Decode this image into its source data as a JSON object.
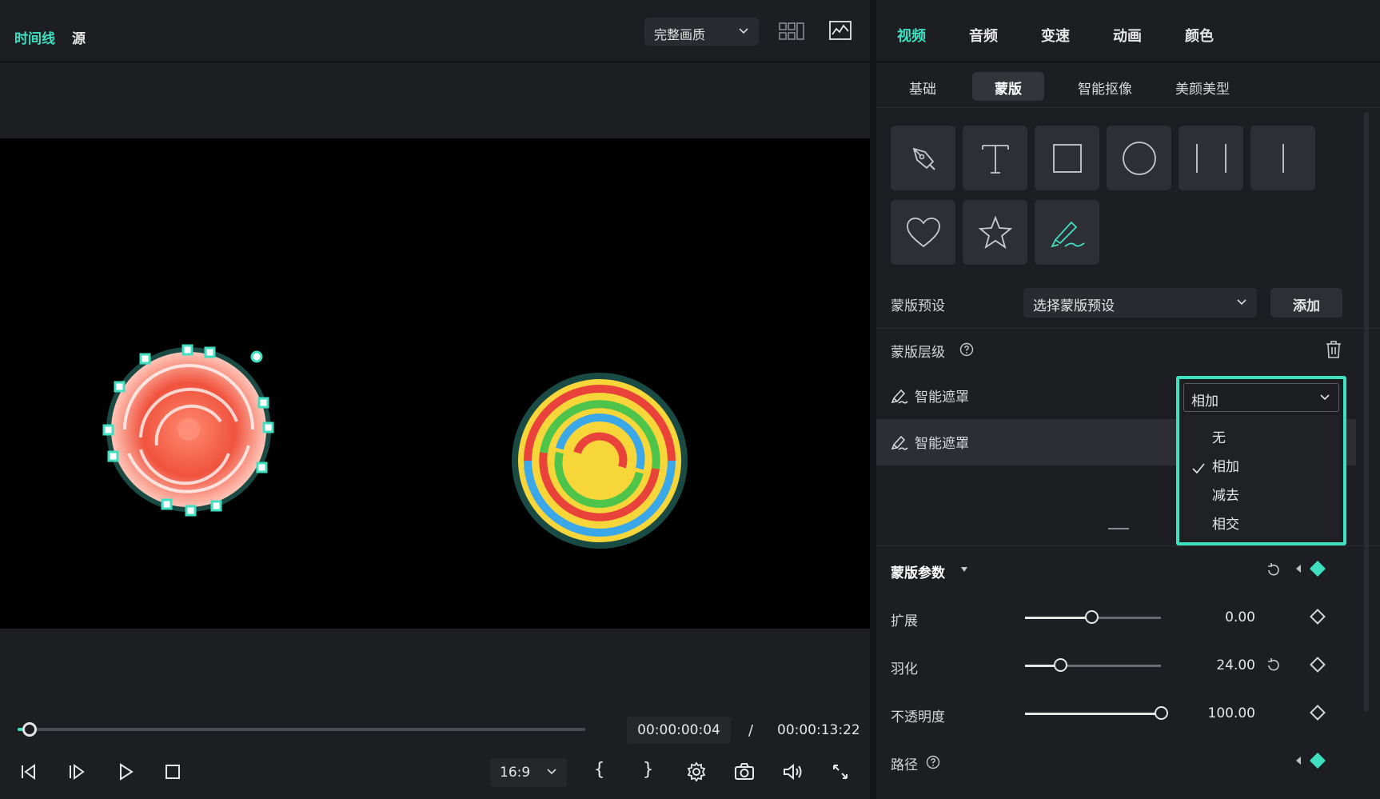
{
  "left": {
    "tabs": {
      "timeline": "时间线",
      "source": "源"
    },
    "quality": {
      "value": "完整画质"
    },
    "time": {
      "current": "00:00:00:04",
      "separator": "/",
      "total": "00:00:13:22"
    },
    "aspect": {
      "value": "16:9"
    },
    "braces": {
      "in": "{",
      "out": "}"
    }
  },
  "right": {
    "tabs": [
      "视频",
      "音频",
      "变速",
      "动画",
      "颜色"
    ],
    "active_tab": "视频",
    "subtabs": [
      "基础",
      "蒙版",
      "智能抠像",
      "美颜美型"
    ],
    "active_subtab": "蒙版",
    "shapes": [
      "pen-icon",
      "text-icon",
      "rectangle-icon",
      "circle-icon",
      "double-line-icon",
      "single-line-icon",
      "heart-icon",
      "star-icon",
      "smart-brush-icon"
    ],
    "preset": {
      "label": "蒙版预设",
      "select": "选择蒙版预设",
      "add": "添加"
    },
    "layers": {
      "title": "蒙版层级",
      "items": [
        "智能遮罩",
        "智能遮罩"
      ]
    },
    "blend": {
      "value": "相加",
      "options": [
        "无",
        "相加",
        "减去",
        "相交"
      ],
      "selected": "相加"
    },
    "params": {
      "title": "蒙版参数",
      "expand": {
        "label": "扩展",
        "value": "0.00",
        "fraction": 0.49
      },
      "feather": {
        "label": "羽化",
        "value": "24.00",
        "fraction": 0.26
      },
      "opacity": {
        "label": "不透明度",
        "value": "100.00",
        "fraction": 1.0
      },
      "path": {
        "label": "路径"
      }
    }
  },
  "colors": {
    "accent": "#3ee0c1",
    "panel": "#1d1e22",
    "viewer": "#000000"
  }
}
